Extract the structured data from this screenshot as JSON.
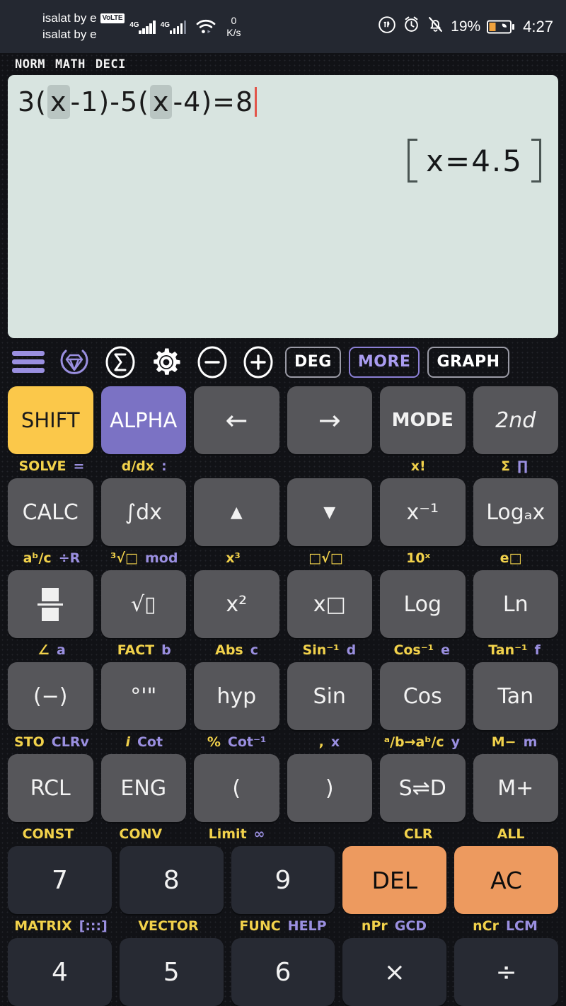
{
  "status_bar": {
    "carrier_line_1": "isalat by e",
    "carrier_line_2": "isalat by e",
    "volte_badge": "VoLTE",
    "network_gen_1": "4G",
    "network_gen_2": "4G",
    "net_speed_value": "0",
    "net_speed_unit": "K/s",
    "battery_percent": "19%",
    "time": "4:27",
    "icons": [
      "data-saver-icon",
      "alarm-clock-icon",
      "bell-muted-icon",
      "wifi-icon",
      "battery-icon"
    ]
  },
  "mode_line": {
    "norm": "NORM",
    "math": "MATH",
    "deci": "DECI"
  },
  "display": {
    "expression_parts": [
      {
        "t": "3(",
        "v": false
      },
      {
        "t": "x",
        "v": true
      },
      {
        "t": "-1)-5(",
        "v": false
      },
      {
        "t": "x",
        "v": true
      },
      {
        "t": "-4)=8",
        "v": false
      }
    ],
    "expression_text": "3(x-1)-5(x-4)=8",
    "result": "x=4.5",
    "background_color": "#d8e4e0",
    "cursor_color": "#e2554a"
  },
  "toolbar": [
    {
      "name": "menu-icon",
      "label": "",
      "kind": "hamburger"
    },
    {
      "name": "premium-gem-icon",
      "label": "",
      "kind": "gem"
    },
    {
      "name": "sigma-icon",
      "label": "Σ",
      "kind": "circle"
    },
    {
      "name": "settings-gear-icon",
      "label": "",
      "kind": "gear"
    },
    {
      "name": "zoom-out-icon",
      "label": "−",
      "kind": "circle"
    },
    {
      "name": "zoom-in-icon",
      "label": "+",
      "kind": "circle"
    },
    {
      "name": "angle-mode-button",
      "label": "DEG",
      "kind": "chip"
    },
    {
      "name": "more-button",
      "label": "MORE",
      "kind": "chip-accent"
    },
    {
      "name": "graph-button",
      "label": "GRAPH",
      "kind": "chip"
    }
  ],
  "keypad": {
    "label_rows": [
      [
        {
          "y": "SOLVE",
          "p": "="
        },
        {
          "y": "d/dx",
          "p": ":"
        },
        {
          "y": "",
          "p": ""
        },
        {
          "y": "",
          "p": ""
        },
        {
          "y": "x!",
          "p": ""
        },
        {
          "y": "Σ",
          "p": "∏"
        }
      ],
      [
        {
          "y": "aᵇ/c",
          "p": "÷R"
        },
        {
          "y": "³√□",
          "p": "mod"
        },
        {
          "y": "x³",
          "p": ""
        },
        {
          "y": "□√□",
          "p": ""
        },
        {
          "y": "10ˣ",
          "p": ""
        },
        {
          "y": "e□",
          "p": ""
        }
      ],
      [
        {
          "y": "∠",
          "p": "a"
        },
        {
          "y": "FACT",
          "p": "b"
        },
        {
          "y": "Abs",
          "p": "c"
        },
        {
          "y": "Sin⁻¹",
          "p": "d"
        },
        {
          "y": "Cos⁻¹",
          "p": "e"
        },
        {
          "y": "Tan⁻¹",
          "p": "f"
        }
      ],
      [
        {
          "y": "STO",
          "p": "CLRv"
        },
        {
          "y": "i",
          "p": "Cot"
        },
        {
          "y": "%",
          "p": "Cot⁻¹"
        },
        {
          "y": ",",
          "p": "x"
        },
        {
          "y": "ᵃ/b→aᵇ/c",
          "p": "y"
        },
        {
          "y": "M−",
          "p": "m"
        }
      ],
      [
        {
          "y": "CONST",
          "p": ""
        },
        {
          "y": "CONV",
          "p": ""
        },
        {
          "y": "Limit",
          "p": "∞"
        },
        {
          "y": "",
          "p": ""
        },
        {
          "y": "CLR",
          "p": ""
        },
        {
          "y": "ALL",
          "p": ""
        }
      ],
      [
        {
          "y": "MATRIX",
          "p": "[:::]"
        },
        {
          "y": "VECTOR",
          "p": ""
        },
        {
          "y": "FUNC",
          "p": "HELP"
        },
        {
          "y": "nPr",
          "p": "GCD"
        },
        {
          "y": "nCr",
          "p": "LCM"
        },
        {
          "y": "",
          "p": ""
        }
      ]
    ],
    "key_rows": [
      [
        {
          "name": "shift-key",
          "label": "SHIFT",
          "style": "shift"
        },
        {
          "name": "alpha-key",
          "label": "ALPHA",
          "style": "alpha"
        },
        {
          "name": "left-arrow-key",
          "label": "←",
          "style": "arrow"
        },
        {
          "name": "right-arrow-key",
          "label": "→",
          "style": "arrow"
        },
        {
          "name": "mode-key",
          "label": "MODE",
          "style": "bold"
        },
        {
          "name": "second-function-key",
          "label": "2nd",
          "style": "italic"
        }
      ],
      [
        {
          "name": "calc-key",
          "label": "CALC",
          "style": ""
        },
        {
          "name": "integral-key",
          "label": "∫dx",
          "style": ""
        },
        {
          "name": "up-arrow-key",
          "label": "▲",
          "style": "tri"
        },
        {
          "name": "down-arrow-key",
          "label": "▼",
          "style": "tri"
        },
        {
          "name": "reciprocal-key",
          "label": "x⁻¹",
          "style": ""
        },
        {
          "name": "log-base-a-key",
          "label": "Logₐx",
          "style": ""
        }
      ],
      [
        {
          "name": "fraction-key",
          "label": "",
          "style": "frac"
        },
        {
          "name": "square-root-key",
          "label": "√▯",
          "style": ""
        },
        {
          "name": "square-key",
          "label": "x²",
          "style": ""
        },
        {
          "name": "power-key",
          "label": "x□",
          "style": ""
        },
        {
          "name": "log-key",
          "label": "Log",
          "style": ""
        },
        {
          "name": "ln-key",
          "label": "Ln",
          "style": ""
        }
      ],
      [
        {
          "name": "negative-sign-key",
          "label": "(−)",
          "style": ""
        },
        {
          "name": "degrees-minutes-seconds-key",
          "label": "°'\"",
          "style": ""
        },
        {
          "name": "hyp-key",
          "label": "hyp",
          "style": ""
        },
        {
          "name": "sin-key",
          "label": "Sin",
          "style": ""
        },
        {
          "name": "cos-key",
          "label": "Cos",
          "style": ""
        },
        {
          "name": "tan-key",
          "label": "Tan",
          "style": ""
        }
      ],
      [
        {
          "name": "recall-key",
          "label": "RCL",
          "style": ""
        },
        {
          "name": "eng-key",
          "label": "ENG",
          "style": ""
        },
        {
          "name": "open-paren-key",
          "label": "(",
          "style": ""
        },
        {
          "name": "close-paren-key",
          "label": ")",
          "style": ""
        },
        {
          "name": "standard-decimal-toggle-key",
          "label": "S⇌D",
          "style": ""
        },
        {
          "name": "memory-plus-key",
          "label": "M+",
          "style": ""
        }
      ],
      [
        {
          "name": "digit-7-key",
          "label": "7",
          "style": "num"
        },
        {
          "name": "digit-8-key",
          "label": "8",
          "style": "num"
        },
        {
          "name": "digit-9-key",
          "label": "9",
          "style": "num"
        },
        {
          "name": "delete-key",
          "label": "DEL",
          "style": "orange"
        },
        {
          "name": "all-clear-key",
          "label": "AC",
          "style": "orange"
        }
      ],
      [
        {
          "name": "digit-4-key",
          "label": "4",
          "style": "num"
        },
        {
          "name": "digit-5-key",
          "label": "5",
          "style": "num"
        },
        {
          "name": "digit-6-key",
          "label": "6",
          "style": "num"
        },
        {
          "name": "multiply-key",
          "label": "×",
          "style": "num"
        },
        {
          "name": "divide-key",
          "label": "÷",
          "style": "num"
        }
      ]
    ]
  },
  "colors": {
    "shift": "#fbc84a",
    "alpha": "#7b72c4",
    "orange_key": "#ed9a5f",
    "yellow_label": "#f2d24b",
    "purple_label": "#9a8fe0",
    "display_bg": "#d8e4e0"
  }
}
